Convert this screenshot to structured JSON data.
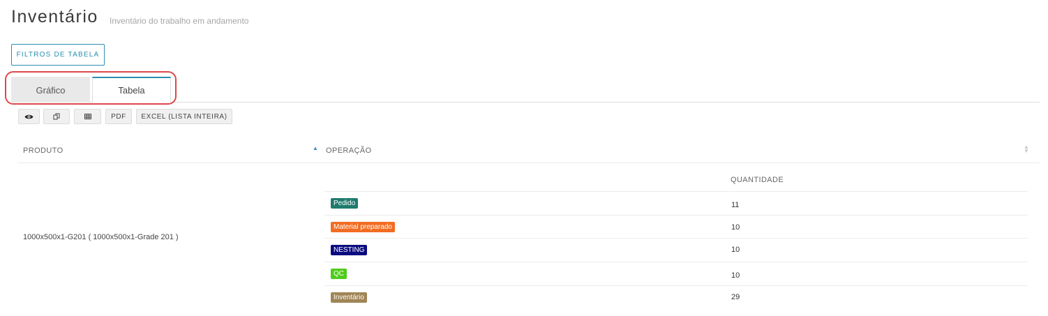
{
  "header": {
    "title": "Inventário",
    "subtitle": "Inventário do trabalho em andamento"
  },
  "filters": {
    "label": "FILTROS DE TABELA"
  },
  "tabs": [
    {
      "label": "Gráfico",
      "active": false
    },
    {
      "label": "Tabela",
      "active": true
    }
  ],
  "toolbar": {
    "view_icon": "eye-icon",
    "copy_icon": "copy-icon",
    "csv_icon": "table-icon",
    "pdf_label": "PDF",
    "excel_label": "EXCEL (LISTA INTEIRA)"
  },
  "table": {
    "columns": [
      "PRODUTO",
      "OPERAÇÃO"
    ],
    "sort": {
      "column": "PRODUTO",
      "direction": "asc"
    },
    "rows": [
      {
        "produto": "1000x500x1-G201 ( 1000x500x1-Grade 201 )",
        "sub_header": "QUANTIDADE",
        "operations": [
          {
            "name": "Pedido",
            "color": "#1f7b6e",
            "quantity": "11"
          },
          {
            "name": "Material preparado",
            "color": "#f26c22",
            "quantity": "10"
          },
          {
            "name": "NESTING",
            "color": "#0c0c80",
            "quantity": "10"
          },
          {
            "name": "QC",
            "color": "#4fcc1a",
            "quantity": "10"
          },
          {
            "name": "Inventário",
            "color": "#a08556",
            "quantity": "29"
          }
        ]
      }
    ]
  },
  "colors": {
    "accent": "#2a8fb0",
    "highlight_outline": "#e0474c"
  }
}
